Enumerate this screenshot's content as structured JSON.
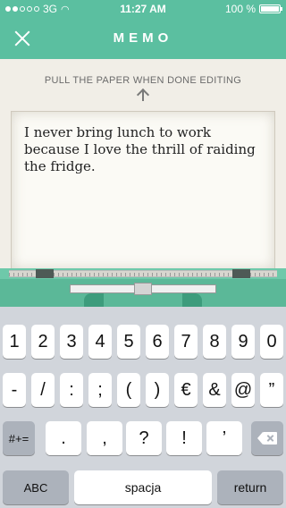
{
  "status_bar": {
    "signal_filled": 2,
    "signal_total": 5,
    "network": "3G",
    "time": "11:27 AM",
    "battery_percent": "100 %",
    "battery_level": 1.0
  },
  "header": {
    "title": "MEMO",
    "close_icon": "close-x-icon",
    "color": "#5bbfa0"
  },
  "hint": {
    "text": "PULL THE PAPER WHEN DONE EDITING",
    "icon": "arrow-up-icon"
  },
  "paper": {
    "text": "I never bring lunch to work because I love the thrill of raiding the fridge."
  },
  "keyboard": {
    "row1": [
      "1",
      "2",
      "3",
      "4",
      "5",
      "6",
      "7",
      "8",
      "9",
      "0"
    ],
    "row2": [
      "-",
      "/",
      ":",
      ";",
      "(",
      ")",
      "€",
      "&",
      "@",
      "”"
    ],
    "mode_key": "#+=",
    "row3": [
      ".",
      ",",
      "?",
      "!",
      "’"
    ],
    "backspace_icon": "backspace-icon",
    "abc_key": "ABC",
    "space_key": "spacja",
    "return_key": "return"
  }
}
